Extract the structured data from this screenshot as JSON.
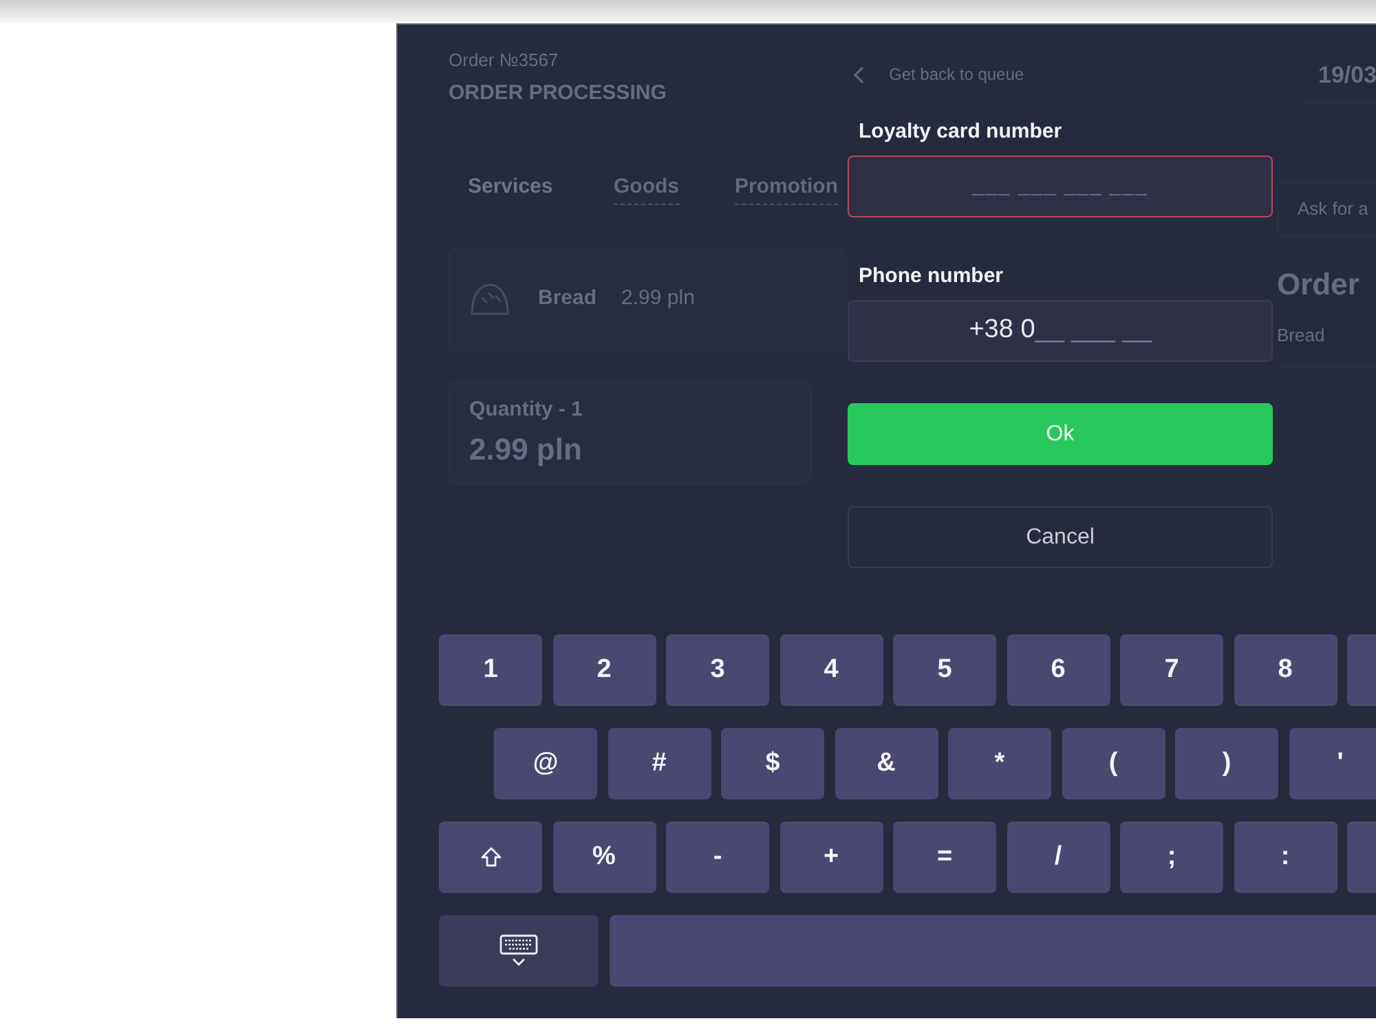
{
  "background_screen": {
    "order_number": "Order №3567",
    "title": "ORDER PROCESSING",
    "back_link": "Get back to queue",
    "date": "19/03",
    "tabs": [
      {
        "label": "Services",
        "selected": true
      },
      {
        "label": "Goods",
        "selected": false
      },
      {
        "label": "Promotion",
        "selected": false
      }
    ],
    "product": {
      "name": "Bread",
      "price": "2.99 pln"
    },
    "quantity": {
      "label": "Quantity - 1",
      "total": "2.99 pln"
    },
    "side_panel": {
      "button": "Ask for a",
      "title": "Order",
      "items": [
        "Bread"
      ]
    }
  },
  "dialog": {
    "fields": [
      {
        "label": "Loyalty card number",
        "placeholder": "___ ___ ___ ___",
        "error": true
      },
      {
        "label": "Phone number",
        "value": "+38 0",
        "mask": "__ ___ __",
        "error": false
      }
    ],
    "buttons": [
      {
        "label": "Ok",
        "kind": "primary"
      },
      {
        "label": "Cancel",
        "kind": "secondary"
      }
    ]
  },
  "keyboard": {
    "rows": [
      [
        {
          "kind": "char",
          "label": "1"
        },
        {
          "kind": "char",
          "label": "2"
        },
        {
          "kind": "char",
          "label": "3"
        },
        {
          "kind": "char",
          "label": "4"
        },
        {
          "kind": "char",
          "label": "5"
        },
        {
          "kind": "char",
          "label": "6"
        },
        {
          "kind": "char",
          "label": "7"
        },
        {
          "kind": "char",
          "label": "8"
        },
        {
          "kind": "partial"
        }
      ],
      [
        {
          "kind": "char",
          "label": "@"
        },
        {
          "kind": "char",
          "label": "#"
        },
        {
          "kind": "char",
          "label": "$"
        },
        {
          "kind": "char",
          "label": "&"
        },
        {
          "kind": "char",
          "label": "*"
        },
        {
          "kind": "char",
          "label": "("
        },
        {
          "kind": "char",
          "label": ")"
        },
        {
          "kind": "char",
          "label": "'"
        }
      ],
      [
        {
          "kind": "shift"
        },
        {
          "kind": "char",
          "label": "%"
        },
        {
          "kind": "char",
          "label": "-"
        },
        {
          "kind": "char",
          "label": "+"
        },
        {
          "kind": "char",
          "label": "="
        },
        {
          "kind": "char",
          "label": "/"
        },
        {
          "kind": "char",
          "label": ";"
        },
        {
          "kind": "char",
          "label": ":"
        },
        {
          "kind": "partial"
        }
      ],
      [
        {
          "kind": "hide"
        },
        {
          "kind": "space"
        }
      ]
    ]
  }
}
